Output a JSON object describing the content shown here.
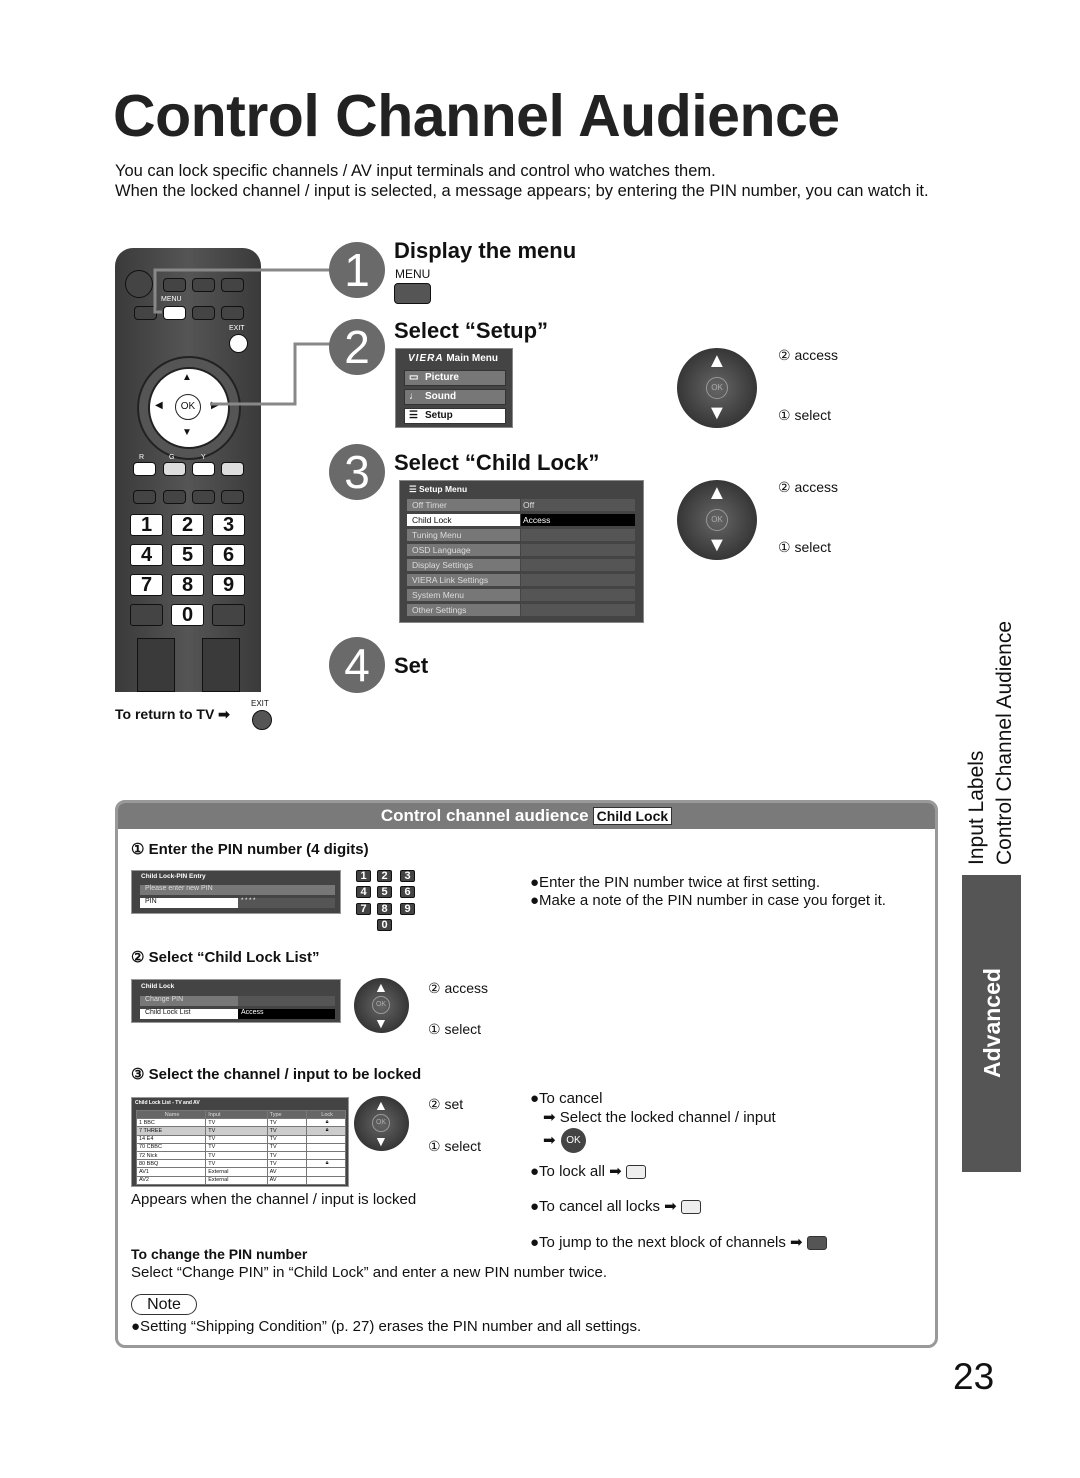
{
  "title": "Control Channel Audience",
  "intro": [
    "You can lock specific channels / AV input terminals and control who watches them.",
    "When the locked channel / input is selected, a message appears; by entering the PIN number, you can watch it."
  ],
  "remote": {
    "menu": "MENU",
    "exit": "EXIT",
    "r": "R",
    "g": "G",
    "y": "Y",
    "ok": "OK",
    "digits": [
      "1",
      "2",
      "3",
      "4",
      "5",
      "6",
      "7",
      "8",
      "9",
      "0"
    ]
  },
  "return_tv": "To return to TV",
  "exit_label": "EXIT",
  "steps": [
    {
      "num": "1",
      "heading": "Display the menu",
      "key": "MENU"
    },
    {
      "num": "2",
      "heading": "Select “Setup”"
    },
    {
      "num": "3",
      "heading": "Select “Child Lock”"
    },
    {
      "num": "4",
      "heading": "Set"
    }
  ],
  "main_menu": {
    "brand": "VIERA",
    "title": "Main Menu",
    "items": [
      "Picture",
      "Sound",
      "Setup"
    ],
    "selected": "Setup"
  },
  "setup_menu": {
    "title": "Setup Menu",
    "items": [
      {
        "label": "Off Timer",
        "value": "Off"
      },
      {
        "label": "Child Lock",
        "value": "Access"
      },
      {
        "label": "Tuning Menu",
        "value": ""
      },
      {
        "label": "OSD Language",
        "value": ""
      },
      {
        "label": "Display Settings",
        "value": ""
      },
      {
        "label": "VIERA Link Settings",
        "value": ""
      },
      {
        "label": "System Menu",
        "value": ""
      },
      {
        "label": "Other Settings",
        "value": ""
      }
    ],
    "selected": "Child Lock"
  },
  "nav": {
    "access": "② access",
    "select": "① select",
    "set": "② set",
    "ok": "OK"
  },
  "side": {
    "labels": "Input Labels",
    "current": "Control Channel Audience",
    "section": "Advanced"
  },
  "box": {
    "title": "Control channel audience",
    "tag": "Child Lock",
    "s1": "① Enter the PIN number (4 digits)",
    "pin": {
      "title": "Child Lock-PIN Entry",
      "prompt": "Please enter new PIN",
      "label": "PIN",
      "value": "* * * *"
    },
    "pin_notes": [
      "●Enter the PIN number twice at first setting.",
      "●Make a note of the PIN number in case you forget it."
    ],
    "s2": "② Select “Child Lock List”",
    "cl": {
      "title": "Child Lock",
      "items": [
        {
          "label": "Change PIN",
          "value": ""
        },
        {
          "label": "Child Lock List",
          "value": "Access"
        }
      ]
    },
    "s3": "③ Select the channel / input to be locked",
    "list": {
      "title": "Child Lock List - TV and AV",
      "headers": [
        "Name",
        "Input",
        "Type",
        "Lock"
      ],
      "rows": [
        [
          "1 BBC",
          "TV",
          "TV",
          "locked"
        ],
        [
          "7 THREE",
          "TV",
          "TV",
          "locked"
        ],
        [
          "14 E4",
          "TV",
          "TV",
          ""
        ],
        [
          "70 CBBC",
          "TV",
          "TV",
          ""
        ],
        [
          "72 Nick",
          "TV",
          "TV",
          ""
        ],
        [
          "80 BBQ",
          "TV",
          "TV",
          "locked"
        ],
        [
          "AV1",
          "External",
          "AV",
          ""
        ],
        [
          "AV2",
          "External",
          "AV",
          ""
        ]
      ]
    },
    "appears": "Appears when the channel / input is locked",
    "cancel": "●To cancel",
    "cancel_sub": "Select the locked channel / input",
    "lock_all": "●To lock all",
    "cancel_all": "●To cancel all locks",
    "jump": "●To jump to the next block of channels",
    "change_pin_h": "To change the PIN number",
    "change_pin": "Select “Change PIN” in “Child Lock” and enter a new PIN number twice.",
    "note_label": "Note",
    "note": "●Setting “Shipping Condition” (p. 27) erases the PIN number and all settings."
  },
  "page_number": "23"
}
